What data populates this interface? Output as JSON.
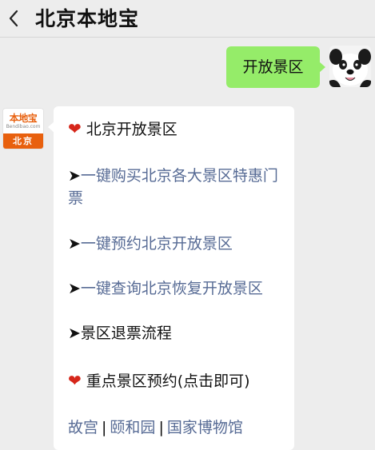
{
  "header": {
    "title": "北京本地宝",
    "back_icon": "chevron-left-icon"
  },
  "user_message": {
    "text": "开放景区",
    "bubble_color": "#95ec69"
  },
  "bot": {
    "avatar": {
      "logo_text": "本地宝",
      "logo_sub": "Bendibao.com",
      "city": "北京",
      "brand_color": "#e8600e"
    },
    "reply": {
      "heading": "北京开放景区",
      "heart_icon": "red-heart-icon",
      "arrow": "➤",
      "items": [
        "一键购买北京各大景区特惠门票",
        "一键预约北京开放景区",
        "一键查询北京恢复开放景区",
        "景区退票流程"
      ],
      "section2_title": "重点景区预约(点击即可)",
      "links": [
        "故宫",
        "颐和园",
        "国家博物馆"
      ],
      "link_separator": "|",
      "link_color": "#576b95"
    }
  }
}
